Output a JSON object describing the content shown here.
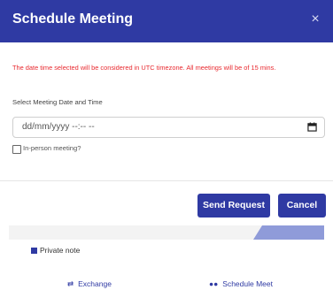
{
  "modal": {
    "title": "Schedule Meeting",
    "close_label": "×",
    "warning": "The date time selected will be considered in UTC timezone. All meetings will be of 15 mins.",
    "date_label": "Select Meeting Date and Time",
    "date_placeholder": "dd/mm/yyyy --:-- --",
    "in_person_label": "In-person meeting?",
    "in_person_checked": false,
    "send_button": "Send Request",
    "cancel_button": "Cancel"
  },
  "background": {
    "private_note": "Private note",
    "links": [
      {
        "label": "Exchange",
        "icon": "exchange-icon"
      },
      {
        "label": "Schedule Meet",
        "icon": "users-icon"
      }
    ]
  },
  "colors": {
    "primary": "#2f3aa3",
    "warning": "#e8292f"
  }
}
